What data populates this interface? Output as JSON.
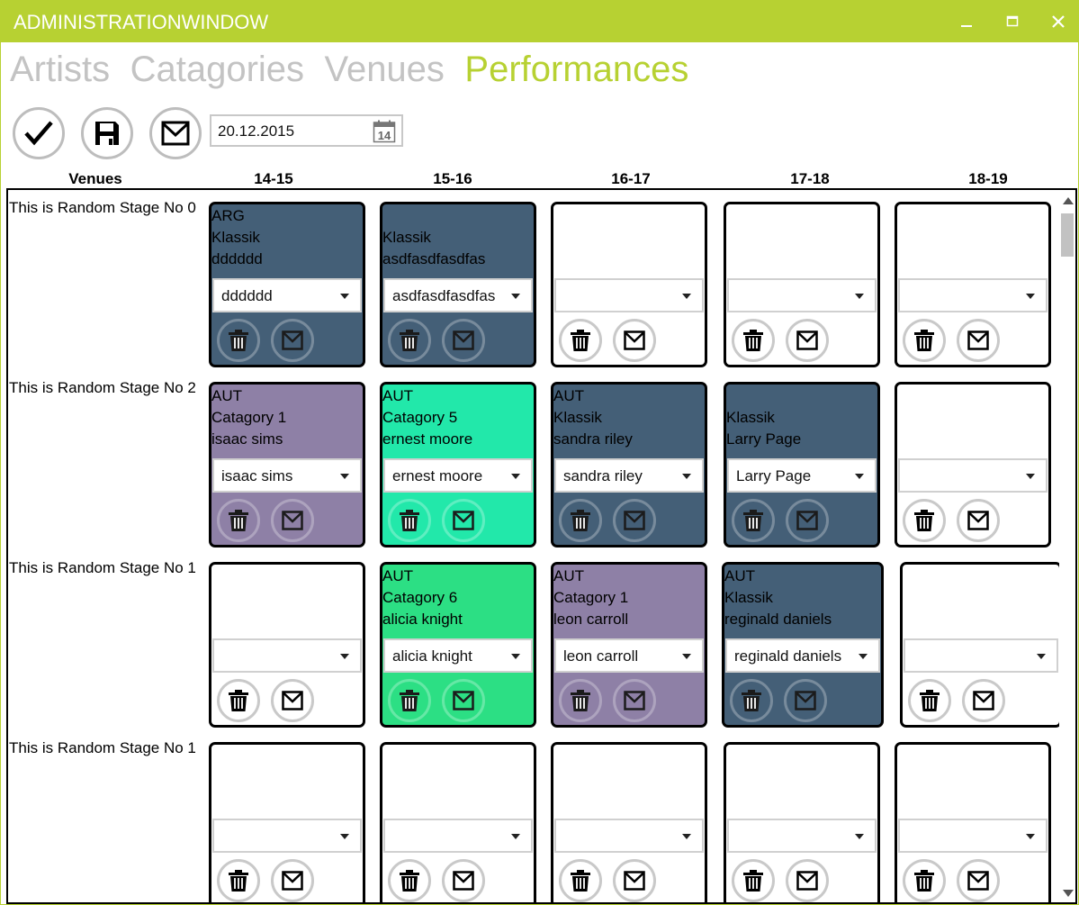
{
  "window": {
    "title": "ADMINISTRATIONWINDOW",
    "accent_color": "#b7d132",
    "controls": [
      "minimize-icon",
      "maximize-icon",
      "close-icon"
    ]
  },
  "nav": {
    "tabs": [
      {
        "label": "Artists",
        "active": false
      },
      {
        "label": "Catagories",
        "active": false
      },
      {
        "label": "Venues",
        "active": false
      },
      {
        "label": "Performances",
        "active": true
      }
    ]
  },
  "toolbar": {
    "buttons": [
      "checkmark-icon",
      "save-icon",
      "mail-icon"
    ],
    "date": "20.12.2015",
    "calendar_icon_day": "14"
  },
  "grid": {
    "venues_header": "Venues",
    "time_slots": [
      "14-15",
      "15-16",
      "16-17",
      "17-18",
      "18-19"
    ],
    "rows": [
      {
        "venue": "This is Random Stage No 0",
        "cells": [
          {
            "country": "ARG",
            "category": "Klassik",
            "artist": "dddddd",
            "selected": "dddddd",
            "color": "#445f77"
          },
          {
            "country": "",
            "category": "Klassik",
            "artist": "asdfasdfasdfas",
            "selected": "asdfasdfasdfas",
            "color": "#445f77"
          },
          {
            "country": "",
            "category": "",
            "artist": "",
            "selected": "",
            "color": ""
          },
          {
            "country": "",
            "category": "",
            "artist": "",
            "selected": "",
            "color": ""
          },
          {
            "country": "",
            "category": "",
            "artist": "",
            "selected": "",
            "color": ""
          }
        ]
      },
      {
        "venue": "This is Random Stage No 2",
        "cells": [
          {
            "country": "AUT",
            "category": "Catagory 1",
            "artist": "isaac sims",
            "selected": "isaac sims",
            "color": "#8e80a6"
          },
          {
            "country": "AUT",
            "category": "Catagory 5",
            "artist": "ernest moore",
            "selected": "ernest moore",
            "color": "#22e8aa"
          },
          {
            "country": "AUT",
            "category": "Klassik",
            "artist": "sandra riley",
            "selected": "sandra riley",
            "color": "#445f77"
          },
          {
            "country": "",
            "category": "Klassik",
            "artist": "Larry Page",
            "selected": "Larry Page",
            "color": "#445f77"
          },
          {
            "country": "",
            "category": "",
            "artist": "",
            "selected": "",
            "color": ""
          }
        ]
      },
      {
        "venue": "This is Random Stage No 1",
        "cells": [
          {
            "country": "",
            "category": "",
            "artist": "",
            "selected": "",
            "color": ""
          },
          {
            "country": "AUT",
            "category": "Catagory 6",
            "artist": "alicia knight",
            "selected": "alicia knight",
            "color": "#2cdf84"
          },
          {
            "country": "AUT",
            "category": "Catagory 1",
            "artist": "leon carroll",
            "selected": "leon carroll",
            "color": "#8e80a6"
          },
          {
            "country": "AUT",
            "category": "Klassik",
            "artist": "reginald daniels",
            "selected": "reginald daniels",
            "color": "#445f77"
          },
          {
            "country": "",
            "category": "",
            "artist": "",
            "selected": "",
            "color": ""
          }
        ]
      },
      {
        "venue": "This is Random Stage No 1",
        "cells": [
          {
            "country": "",
            "category": "",
            "artist": "",
            "selected": "",
            "color": ""
          },
          {
            "country": "",
            "category": "",
            "artist": "",
            "selected": "",
            "color": ""
          },
          {
            "country": "",
            "category": "",
            "artist": "",
            "selected": "",
            "color": ""
          },
          {
            "country": "",
            "category": "",
            "artist": "",
            "selected": "",
            "color": ""
          },
          {
            "country": "",
            "category": "",
            "artist": "",
            "selected": "",
            "color": ""
          }
        ]
      }
    ],
    "cell_icons": [
      "trash-icon",
      "mail-icon"
    ]
  }
}
